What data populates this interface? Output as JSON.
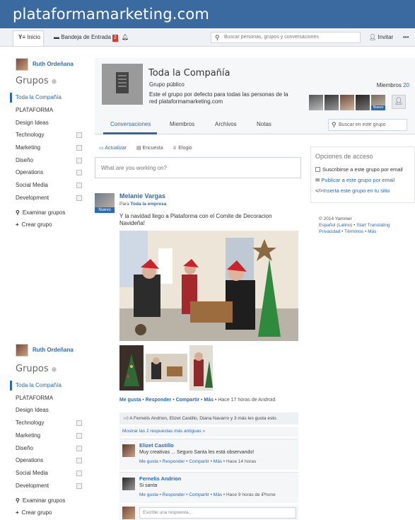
{
  "brand": {
    "title": "plataformamarketing.com"
  },
  "nav": {
    "home": "Inicio",
    "inbox": "Bandeja de Entrada",
    "inbox_count": "2",
    "search_placeholder": "Buscar personas, grupos y conversaciones",
    "invite": "Invitar",
    "more": "•••"
  },
  "sidebar": {
    "user_name": "Ruth Ordeñana",
    "groups_heading": "Grupos",
    "groups": [
      {
        "label": "Toda la Compañía"
      },
      {
        "label": "PLATAFORMA"
      },
      {
        "label": "Design Ideas"
      },
      {
        "label": "Technology"
      },
      {
        "label": "Marketing"
      },
      {
        "label": "Diseño"
      },
      {
        "label": "Operations"
      },
      {
        "label": "Social Media"
      },
      {
        "label": "Development"
      }
    ],
    "browse": "Examinar grupos",
    "create": "Crear grupo"
  },
  "group": {
    "title": "Toda la Compañía",
    "type": "Grupo público",
    "description": "Este el grupo por defecto para todas las personas de la red plataformamarketing.com",
    "members_label": "Miembros",
    "members_count": "20",
    "new_badge": "Nuevo"
  },
  "tabs": [
    {
      "label": "Conversaciones"
    },
    {
      "label": "Miembros"
    },
    {
      "label": "Archivos"
    },
    {
      "label": "Notas"
    }
  ],
  "group_search_placeholder": "Buscar en este grupo",
  "composer": {
    "tabs": [
      "Actualizar",
      "Encuesta",
      "Elogio"
    ],
    "placeholder": "What are you working on?"
  },
  "access": {
    "heading": "Opciones de acceso",
    "subscribe": "Suscribirse a este grupo por email",
    "post_email": "Publicar a este grupo por email",
    "embed": "Inserta este grupo en tu sitio"
  },
  "footer": {
    "copyright": "© 2014 Yammer",
    "lang": "Español (Latino)",
    "translate": "Start Translating",
    "links": "Privacidad • Términos • Más"
  },
  "post": {
    "author": "Melanie Vargas",
    "to_prefix": "Para",
    "to": "Toda la empresa",
    "new_badge": "Nuevo",
    "text": "Y la navidad llego a Plataforma con el Comite de Decoracion Navideña!",
    "actions": [
      "Me gusta",
      "Responder",
      "Compartir",
      "Más"
    ],
    "time": "Hace 17 horas de Android",
    "likes": "A Fernelis Andrion, Elizet Castillo, Diana Navarro y 3 más les gusta esto.",
    "older": "Mostrar las 2 respuestas más antiguas »"
  },
  "replies": [
    {
      "name": "Elizet Castillo",
      "text": "Muy creativas ... Seguro Santa les está observando!",
      "actions": [
        "Me gusta",
        "Responder",
        "Compartir",
        "Más"
      ],
      "time": "Hace 14 horas"
    },
    {
      "name": "Fernelis Andrion",
      "text": "Si santa",
      "actions": [
        "Me gusta",
        "Responder",
        "Compartir",
        "Más"
      ],
      "time": "Hace 9 horas de iPhone"
    }
  ],
  "reply_placeholder": "Escribe una respuesta...",
  "sidebar2": {
    "user_name": "Ruth Ordeñana",
    "groups_heading": "Grupos",
    "groups": [
      {
        "label": "Toda la Compañía"
      },
      {
        "label": "PLATAFORMA"
      },
      {
        "label": "Design Ideas"
      },
      {
        "label": "Technology"
      },
      {
        "label": "Marketing"
      },
      {
        "label": "Diseño"
      },
      {
        "label": "Operations"
      },
      {
        "label": "Social Media"
      },
      {
        "label": "Development"
      }
    ],
    "browse": "Examinar grupos",
    "create": "Crear grupo"
  },
  "colors": {
    "brand": "#3b6aa0",
    "link": "#2a6ab2",
    "badge": "#d63a2f"
  }
}
